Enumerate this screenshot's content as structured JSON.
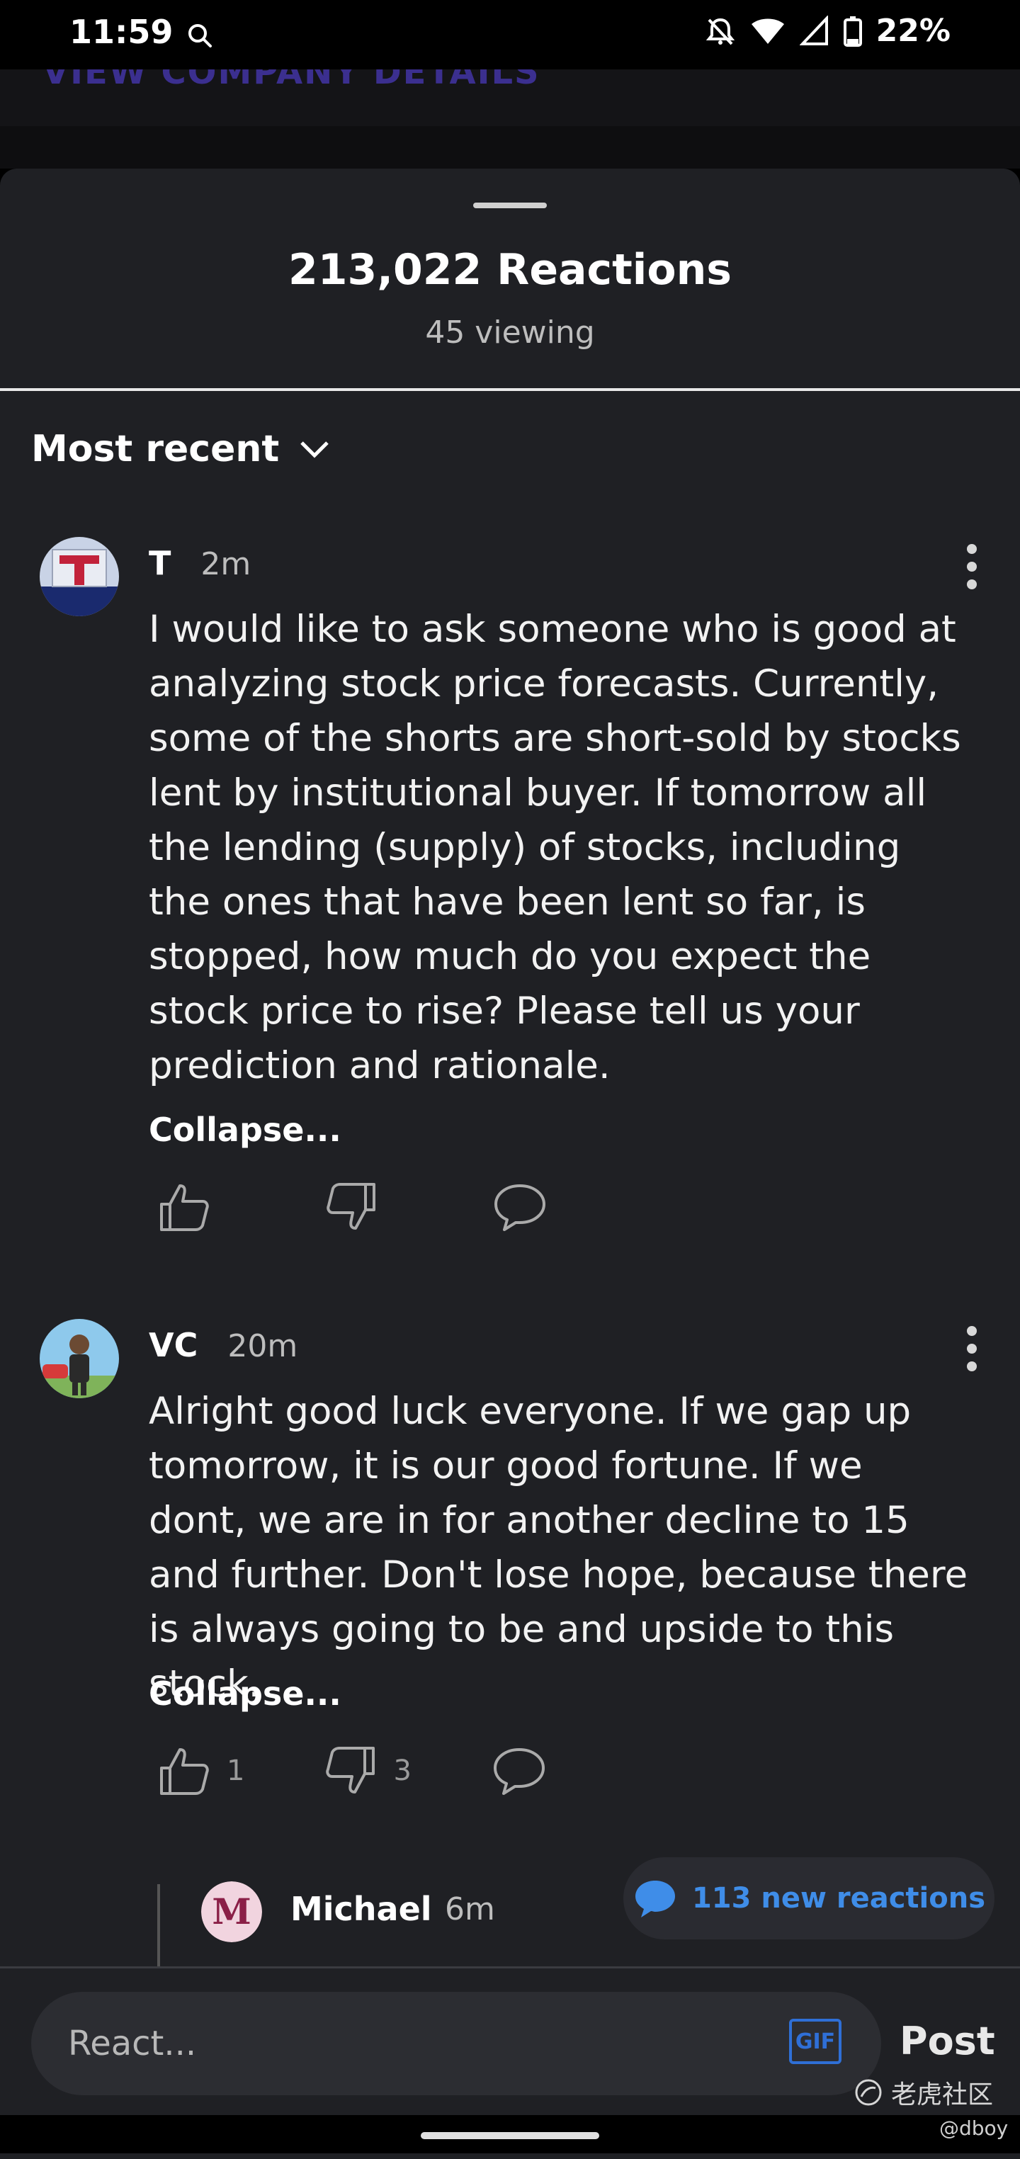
{
  "status_bar": {
    "time": "11:59",
    "battery": "22%",
    "icons": [
      "search-icon",
      "dnd-bell-off-icon",
      "wifi-icon",
      "signal-icon",
      "battery-icon"
    ]
  },
  "background": {
    "link": "VIEW COMPANY DETAILS"
  },
  "sheet": {
    "title": "213,022 Reactions",
    "viewing": "45 viewing",
    "sort_label": "Most recent"
  },
  "comments": [
    {
      "user": "T",
      "time": "2m",
      "body": "I would like to ask someone who is good at analyzing stock price forecasts. Currently, some of the shorts are short-sold by stocks lent by institutional buyer. If tomorrow all the lending (supply) of stocks, including the ones that have been lent so far, is stopped, how much do you expect the stock price to rise? Please tell us your prediction and rationale.",
      "collapse": "Collapse...",
      "likes": "",
      "dislikes": ""
    },
    {
      "user": "VC",
      "time": "20m",
      "body": "Alright good luck everyone. If we gap up tomorrow, it is our good fortune. If we dont, we are in for another decline to 15 and further. Don't lose hope, because there is always going to be and upside to this stock.",
      "collapse": "Collapse...",
      "likes": "1",
      "dislikes": "3"
    }
  ],
  "reply": {
    "user": "Michael",
    "time": "6m",
    "avatar_letter": "M"
  },
  "new_reactions": "113 new reactions",
  "composer": {
    "placeholder": "React...",
    "gif_label": "GIF",
    "post_label": "Post"
  },
  "watermark": {
    "text": "老虎社区",
    "credit": "@dboy"
  },
  "colors": {
    "sheet_bg": "#1f2024",
    "accent_blue": "#3f8de8",
    "muted_text": "#bdbdbd"
  }
}
